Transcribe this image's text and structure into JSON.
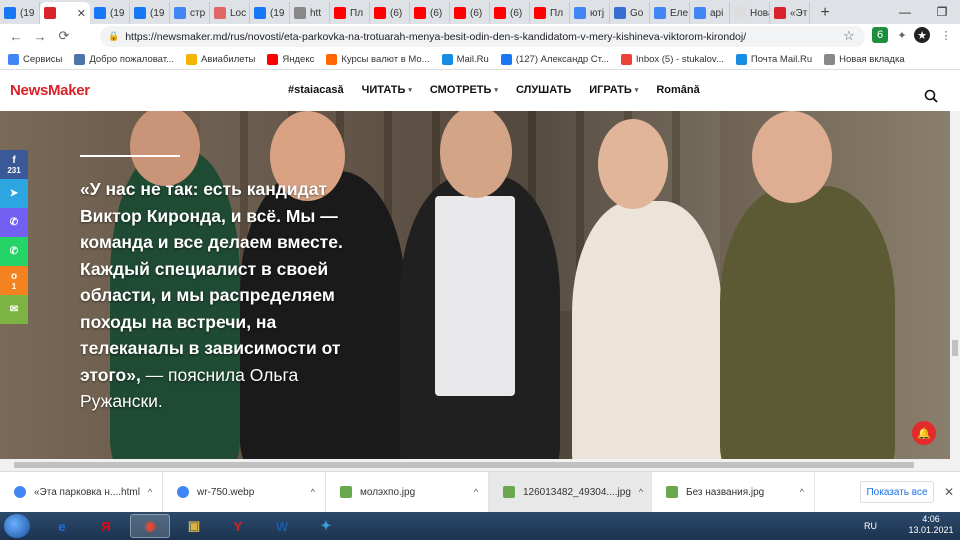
{
  "tabs": [
    {
      "label": "(19",
      "color": "#1877f2",
      "active": false
    },
    {
      "label": "",
      "color": "#d8232a",
      "active": true
    },
    {
      "label": "(19",
      "color": "#1877f2",
      "active": false
    },
    {
      "label": "(19",
      "color": "#1877f2",
      "active": false
    },
    {
      "label": "стр",
      "color": "#4285f4",
      "active": false
    },
    {
      "label": "Loc",
      "color": "#e06666",
      "active": false
    },
    {
      "label": "(19",
      "color": "#1877f2",
      "active": false
    },
    {
      "label": "htt",
      "color": "#888888",
      "active": false
    },
    {
      "label": "Пл",
      "color": "#ff0000",
      "active": false
    },
    {
      "label": "(6)",
      "color": "#ff0000",
      "active": false
    },
    {
      "label": "(6)",
      "color": "#ff0000",
      "active": false
    },
    {
      "label": "(6)",
      "color": "#ff0000",
      "active": false
    },
    {
      "label": "(6)",
      "color": "#ff0000",
      "active": false
    },
    {
      "label": "Пл",
      "color": "#ff0000",
      "active": false
    },
    {
      "label": "ютj",
      "color": "#4285f4",
      "active": false
    },
    {
      "label": "Go",
      "color": "#3b6ed1",
      "active": false
    },
    {
      "label": "Еле",
      "color": "#4285f4",
      "active": false
    },
    {
      "label": "арі",
      "color": "#4285f4",
      "active": false
    },
    {
      "label": "Новая",
      "color": "#dddddd",
      "active": false
    },
    {
      "label": "«Эт",
      "color": "#d8232a",
      "active": false
    }
  ],
  "active_tab_close": "✕",
  "new_tab_label": "+",
  "window_controls": {
    "minimize": "—",
    "maximize": "❐",
    "close": "✕"
  },
  "toolbar": {
    "back": "←",
    "forward": "→",
    "reload": "⟳",
    "url": "https://newsmaker.md/rus/novosti/eta-parkovka-na-trotuarah-menya-besit-odin-den-s-kandidatom-v-mery-kishineva-viktorom-kirondoj/",
    "lock": "🔒",
    "star": "☆",
    "extensions": [
      "6",
      "✦",
      "★"
    ]
  },
  "bookmarks": [
    {
      "label": "Сервисы",
      "color": "#4285f4"
    },
    {
      "label": "Добро пожаловат...",
      "color": "#4a76a8"
    },
    {
      "label": "Авиабилеты",
      "color": "#f5b400"
    },
    {
      "label": "Яндекс",
      "color": "#ff0000"
    },
    {
      "label": "Курсы валют в Мо...",
      "color": "#ff6600"
    },
    {
      "label": "Mail.Ru",
      "color": "#168de2"
    },
    {
      "label": "(127) Александр Ст...",
      "color": "#1877f2"
    },
    {
      "label": "Inbox (5) - stukalov...",
      "color": "#ea4335"
    },
    {
      "label": "Почта Mail.Ru",
      "color": "#168de2"
    },
    {
      "label": "Новая вкладка",
      "color": "#888888"
    }
  ],
  "site": {
    "logo": "NewsMaker",
    "nav": [
      {
        "label": "#staiacasă",
        "caret": false
      },
      {
        "label": "ЧИТАТЬ",
        "caret": true
      },
      {
        "label": "СМОТРЕТЬ",
        "caret": true
      },
      {
        "label": "СЛУШАТЬ",
        "caret": false
      },
      {
        "label": "ИГРАТЬ",
        "caret": true
      },
      {
        "label": "Română",
        "caret": false
      }
    ]
  },
  "quote": {
    "bold": "«У нас не так: есть кандидат Виктор Киронда, и всё. Мы — команда и все делаем вместе. Каждый специалист в своей области, и мы распределяем походы на встречи, на телеканалы в зависимости от этого»,",
    "normal": " — пояснила Ольга Ружански."
  },
  "share": [
    {
      "name": "facebook",
      "icon": "f",
      "count": "231",
      "color": "#3b5998"
    },
    {
      "name": "telegram",
      "icon": "➤",
      "count": "",
      "color": "#2ca5e0"
    },
    {
      "name": "viber",
      "icon": "✆",
      "count": "",
      "color": "#7360f2"
    },
    {
      "name": "whatsapp",
      "icon": "✆",
      "count": "",
      "color": "#25d366"
    },
    {
      "name": "odnoklassniki",
      "icon": "о",
      "count": "1",
      "color": "#f58220"
    },
    {
      "name": "email",
      "icon": "✉",
      "count": "",
      "color": "#7cb342"
    }
  ],
  "notification_icon": "🔔",
  "downloads": [
    {
      "name": "«Эта парковка н....html",
      "icon_color": "#4285f4",
      "selected": false
    },
    {
      "name": "wr-750.webp",
      "icon_color": "#4285f4",
      "selected": false
    },
    {
      "name": "молэхпо.jpg",
      "icon_color": "#6aa84f",
      "selected": false
    },
    {
      "name": "126013482_49304....jpg",
      "icon_color": "#6aa84f",
      "selected": true
    },
    {
      "name": "Без названия.jpg",
      "icon_color": "#6aa84f",
      "selected": false
    }
  ],
  "show_all_label": "Показать все",
  "taskbar": {
    "apps": [
      "e",
      "Я",
      "◉",
      "▣",
      "Y",
      "W",
      "✦"
    ],
    "language": "RU",
    "time": "4:06",
    "date": "13.01.2021"
  }
}
